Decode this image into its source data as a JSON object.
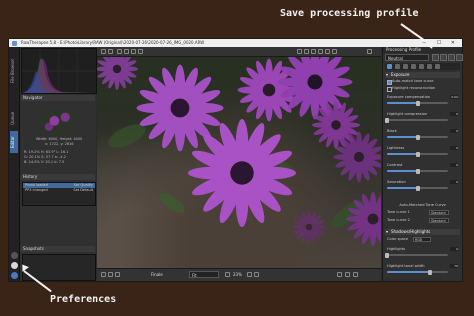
{
  "annotations": {
    "save_profile": "Save processing profile",
    "preferences": "Preferences"
  },
  "window": {
    "title": "RawTherapee 5.8 - E:\\Photo\\Library\\RAW (Original)\\2020-07-26\\2020-07-26_IMG_0020.ARW",
    "controls": "— ☐ ✕"
  },
  "left_tabs": [
    "File Browser",
    "Queue",
    "Editor"
  ],
  "left_panel": {
    "navigator_title": "Navigator",
    "nav_info": [
      "Width: 6000, Height: 4000",
      "x: 1722, y: 2616"
    ],
    "nav_values": [
      "R: 19.2%  H: 63.9°  L: 16.1",
      "G: 20.1%  S: 37.7  a: -4.2",
      "B: 14.5%  V: 20.1  b: 7.5"
    ],
    "history_title": "History",
    "history_rows": [
      {
        "name": "Photo loaded",
        "value": "Set Quality"
      },
      {
        "name": "PP3 changed",
        "value": "Set Default"
      }
    ],
    "snapshots_title": "Snapshots"
  },
  "bottom_toolbar": {
    "mode_label": "Finale",
    "zoom_value": "Fit",
    "zoom_pct": "23%"
  },
  "right_panel": {
    "title": "Processing Profile",
    "profile_value": "Neutral",
    "exposure": {
      "title": "Exposure",
      "auto_match": "Auto-match tone curve",
      "highlight_recon": "Highlight reconstruction",
      "rows": [
        {
          "label": "Exposure compensation",
          "value": "0.00",
          "fraction": 0.5
        },
        {
          "label": "Highlight compression",
          "value": "0",
          "fraction": 0.0
        },
        {
          "label": "Black",
          "value": "0",
          "fraction": 0.5
        },
        {
          "label": "Lightness",
          "value": "0",
          "fraction": 0.5
        },
        {
          "label": "Contrast",
          "value": "0",
          "fraction": 0.5
        },
        {
          "label": "Saturation",
          "value": "0",
          "fraction": 0.5
        }
      ],
      "tone_curve_title": "Auto-Matched Tone Curve",
      "curve1": "Tone curve 1",
      "curve1_mode": "Standard",
      "curve2": "Tone curve 2",
      "curve2_mode": "Standard"
    },
    "shadows": {
      "title": "Shadows/Highlights",
      "color_space_label": "Color space",
      "color_space_value": "RGB",
      "rows": [
        {
          "label": "Highlights",
          "value": "0",
          "fraction": 0.0
        },
        {
          "label": "Highlight tonal width",
          "value": "70",
          "fraction": 0.7
        }
      ]
    }
  }
}
